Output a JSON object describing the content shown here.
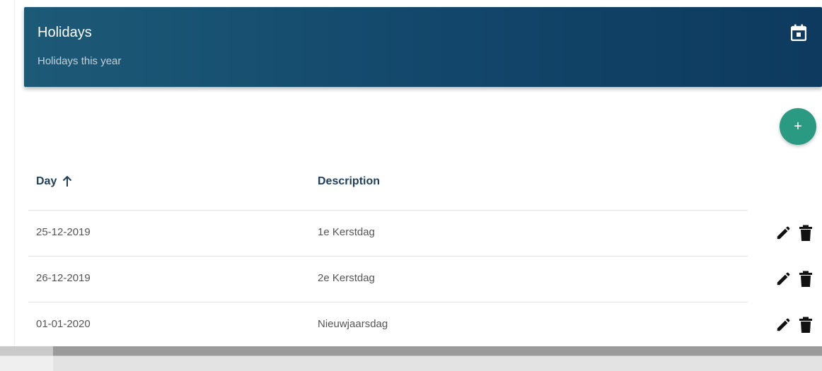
{
  "header": {
    "title": "Holidays",
    "subtitle": "Holidays this year",
    "icon": "calendar-icon",
    "colors": {
      "start": "#1d5a77",
      "end": "#0d3a5e"
    }
  },
  "add_button": {
    "label": "+",
    "color": "#2b9a82"
  },
  "table": {
    "columns": [
      {
        "label": "Day",
        "sort": "ascending"
      },
      {
        "label": "Description"
      }
    ],
    "rows": [
      {
        "day": "25-12-2019",
        "description": "1e Kerstdag"
      },
      {
        "day": "26-12-2019",
        "description": "2e Kerstdag"
      },
      {
        "day": "01-01-2020",
        "description": "Nieuwjaarsdag"
      }
    ],
    "row_actions": [
      "edit-icon",
      "delete-icon"
    ]
  }
}
